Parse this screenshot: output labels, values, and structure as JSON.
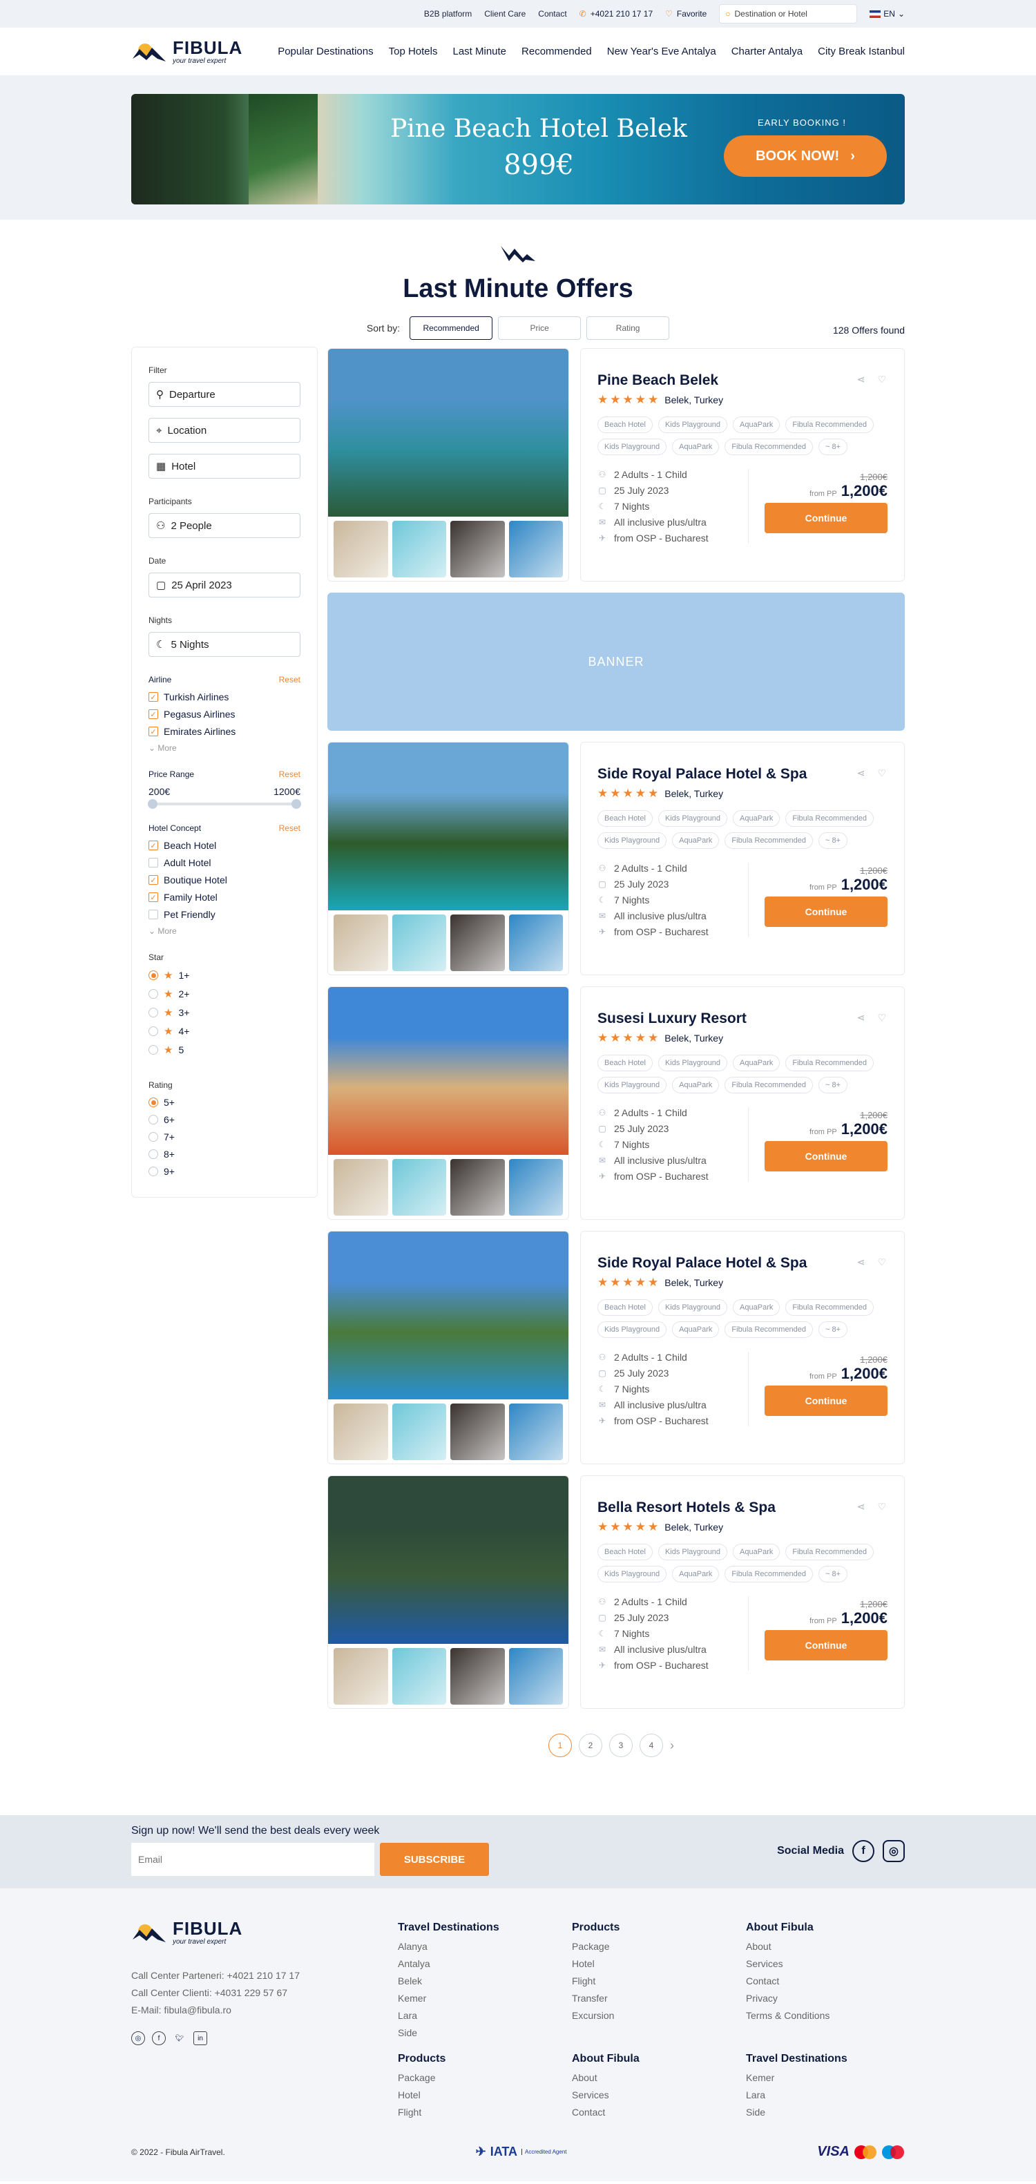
{
  "topbar": {
    "links": [
      "B2B platform",
      "Client Care",
      "Contact"
    ],
    "phone": "+4021 210 17 17",
    "favorite": "Favorite",
    "search_placeholder": "Destination or Hotel",
    "lang": "EN"
  },
  "brand": {
    "name": "FIBULA",
    "tagline": "your travel expert"
  },
  "nav": [
    "Popular Destinations",
    "Top Hotels",
    "Last Minute",
    "Recommended",
    "New Year's Eve Antalya",
    "Charter Antalya",
    "City Break Istanbul"
  ],
  "hero": {
    "title": "Pine Beach Hotel Belek",
    "price": "899€",
    "early": "EARLY BOOKING !",
    "cta": "BOOK NOW!"
  },
  "page_title": "Last Minute Offers",
  "sort": {
    "label": "Sort by:",
    "options": [
      "Recommended",
      "Price",
      "Rating"
    ],
    "active": "Recommended"
  },
  "offers_found": "128 Offers found",
  "filter": {
    "title": "Filter",
    "departure": "Departure",
    "location": "Location",
    "hotel": "Hotel",
    "participants_label": "Participants",
    "participants": "2 People",
    "date_label": "Date",
    "date": "25 April 2023",
    "nights_label": "Nights",
    "nights": "5 Nights",
    "airline_label": "Airline",
    "reset": "Reset",
    "more": "More",
    "airlines": [
      {
        "name": "Turkish Airlines",
        "checked": true
      },
      {
        "name": "Pegasus Airlines",
        "checked": true
      },
      {
        "name": "Emirates Airlines",
        "checked": true
      }
    ],
    "price_label": "Price Range",
    "price_min": "200€",
    "price_max": "1200€",
    "concept_label": "Hotel Concept",
    "concepts": [
      {
        "name": "Beach Hotel",
        "checked": true
      },
      {
        "name": "Adult Hotel",
        "checked": false
      },
      {
        "name": "Boutique Hotel",
        "checked": true
      },
      {
        "name": "Family Hotel",
        "checked": true
      },
      {
        "name": "Pet Friendly",
        "checked": false
      }
    ],
    "star_label": "Star",
    "stars": [
      "1+",
      "2+",
      "3+",
      "4+",
      "5"
    ],
    "rating_label": "Rating",
    "ratings": [
      "5+",
      "6+",
      "7+",
      "8+",
      "9+"
    ]
  },
  "hotels": [
    {
      "name": "Pine Beach Belek",
      "location": "Belek, Turkey",
      "tags": [
        "Beach Hotel",
        "Kids Playground",
        "AquaPark",
        "Fibula Recommended",
        "Kids Playground",
        "AquaPark",
        "Fibula Recommended",
        "8+"
      ],
      "guests": "2 Adults - 1 Child",
      "date": "25 July 2023",
      "nights": "7 Nights",
      "board": "All inclusive plus/ultra",
      "from": "from OSP - Bucharest",
      "old_price": "1,200€",
      "from_pp": "from PP",
      "price": "1,200€",
      "cta": "Continue",
      "colors": [
        "#4f93c9",
        "#2f8f9f",
        "#2a5a38"
      ]
    },
    {
      "name": "Side Royal Palace Hotel & Spa",
      "location": "Belek, Turkey",
      "tags": [
        "Beach Hotel",
        "Kids Playground",
        "AquaPark",
        "Fibula Recommended",
        "Kids Playground",
        "AquaPark",
        "Fibula Recommended",
        "8+"
      ],
      "guests": "2 Adults - 1 Child",
      "date": "25 July 2023",
      "nights": "7 Nights",
      "board": "All inclusive plus/ultra",
      "from": "from OSP - Bucharest",
      "old_price": "1,200€",
      "from_pp": "from PP",
      "price": "1,200€",
      "cta": "Continue",
      "colors": [
        "#6aa6d6",
        "#2e5b2a",
        "#19a7b8"
      ]
    },
    {
      "name": "Susesi Luxury Resort",
      "location": "Belek, Turkey",
      "tags": [
        "Beach Hotel",
        "Kids Playground",
        "AquaPark",
        "Fibula Recommended",
        "Kids Playground",
        "AquaPark",
        "Fibula Recommended",
        "8+"
      ],
      "guests": "2 Adults - 1 Child",
      "date": "25 July 2023",
      "nights": "7 Nights",
      "board": "All inclusive plus/ultra",
      "from": "from OSP - Bucharest",
      "old_price": "1,200€",
      "from_pp": "from PP",
      "price": "1,200€",
      "cta": "Continue",
      "colors": [
        "#3f88d8",
        "#d9b07a",
        "#d9552a"
      ]
    },
    {
      "name": "Side Royal Palace Hotel & Spa",
      "location": "Belek, Turkey",
      "tags": [
        "Beach Hotel",
        "Kids Playground",
        "AquaPark",
        "Fibula Recommended",
        "Kids Playground",
        "AquaPark",
        "Fibula Recommended",
        "8+"
      ],
      "guests": "2 Adults - 1 Child",
      "date": "25 July 2023",
      "nights": "7 Nights",
      "board": "All inclusive plus/ultra",
      "from": "from OSP - Bucharest",
      "old_price": "1,200€",
      "from_pp": "from PP",
      "price": "1,200€",
      "cta": "Continue",
      "colors": [
        "#4c8ed6",
        "#4a7a3a",
        "#2a8fd0"
      ]
    },
    {
      "name": "Bella Resort Hotels & Spa",
      "location": "Belek, Turkey",
      "tags": [
        "Beach Hotel",
        "Kids Playground",
        "AquaPark",
        "Fibula Recommended",
        "Kids Playground",
        "AquaPark",
        "Fibula Recommended",
        "8+"
      ],
      "guests": "2 Adults - 1 Child",
      "date": "25 July 2023",
      "nights": "7 Nights",
      "board": "All inclusive plus/ultra",
      "from": "from OSP - Bucharest",
      "old_price": "1,200€",
      "from_pp": "from PP",
      "price": "1,200€",
      "cta": "Continue",
      "colors": [
        "#2d4a3a",
        "#3a5a3a",
        "#1f5aa8"
      ]
    }
  ],
  "banner": "BANNER",
  "pages": [
    "1",
    "2",
    "3",
    "4"
  ],
  "signup": {
    "title": "Sign up now! We'll send the best deals every week",
    "placeholder": "Email",
    "button": "SUBSCRIBE",
    "social_label": "Social Media"
  },
  "footer": {
    "contact": [
      "Call Center Parteneri: +4021 210 17 17",
      "Call Center Clienti: +4031 229 57 67",
      "E-Mail: fibula@fibula.ro"
    ],
    "columns": [
      {
        "title": "Travel Destinations",
        "items": [
          "Alanya",
          "Antalya",
          "Belek",
          "Kemer",
          "Lara",
          "Side"
        ]
      },
      {
        "title": "Products",
        "items": [
          "Package",
          "Hotel",
          "Flight",
          "Transfer",
          "Excursion"
        ]
      },
      {
        "title": "About Fibula",
        "items": [
          "About",
          "Services",
          "Contact",
          "Privacy",
          "Terms & Conditions"
        ]
      },
      {
        "title": "Products",
        "items": [
          "Package",
          "Hotel",
          "Flight"
        ]
      },
      {
        "title": "About Fibula",
        "items": [
          "About",
          "Services",
          "Contact"
        ]
      },
      {
        "title": "Travel Destinations",
        "items": [
          "Kemer",
          "Lara",
          "Side"
        ]
      }
    ],
    "copyright": "© 2022 - Fibula AirTravel.",
    "iata": "IATA",
    "iata_sub": "Accredited Agent",
    "visa": "VISA"
  }
}
